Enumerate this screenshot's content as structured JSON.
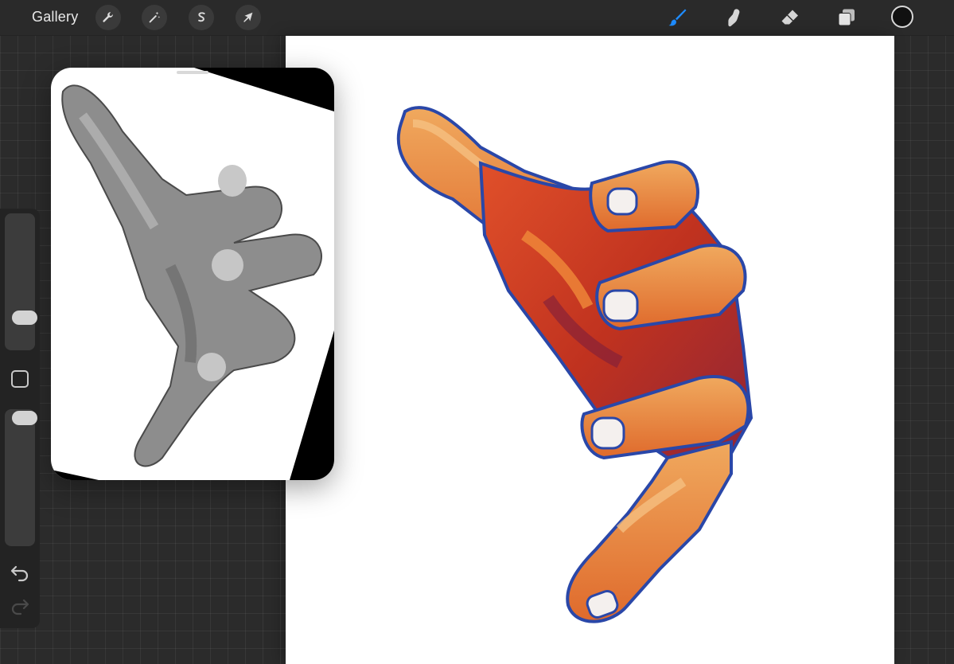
{
  "app": {
    "gallery_label": "Gallery"
  },
  "toolbar_left": [
    {
      "name": "actions",
      "icon": "wrench-icon"
    },
    {
      "name": "adjustments",
      "icon": "magic-wand-icon"
    },
    {
      "name": "selection",
      "icon": "selection-s-icon"
    },
    {
      "name": "transform",
      "icon": "arrow-cursor-icon"
    }
  ],
  "toolbar_right": [
    {
      "name": "brush",
      "icon": "brush-icon",
      "active": true
    },
    {
      "name": "smudge",
      "icon": "smudge-finger-icon",
      "active": false
    },
    {
      "name": "eraser",
      "icon": "eraser-icon",
      "active": false
    },
    {
      "name": "layers",
      "icon": "layers-icon",
      "active": false
    }
  ],
  "colors": {
    "active_tool": "#1e8cff",
    "current_color": "#111111",
    "canvas": "#ffffff"
  },
  "sidebar": {
    "brush_size_level": 0.8,
    "opacity_level": 0.0
  }
}
